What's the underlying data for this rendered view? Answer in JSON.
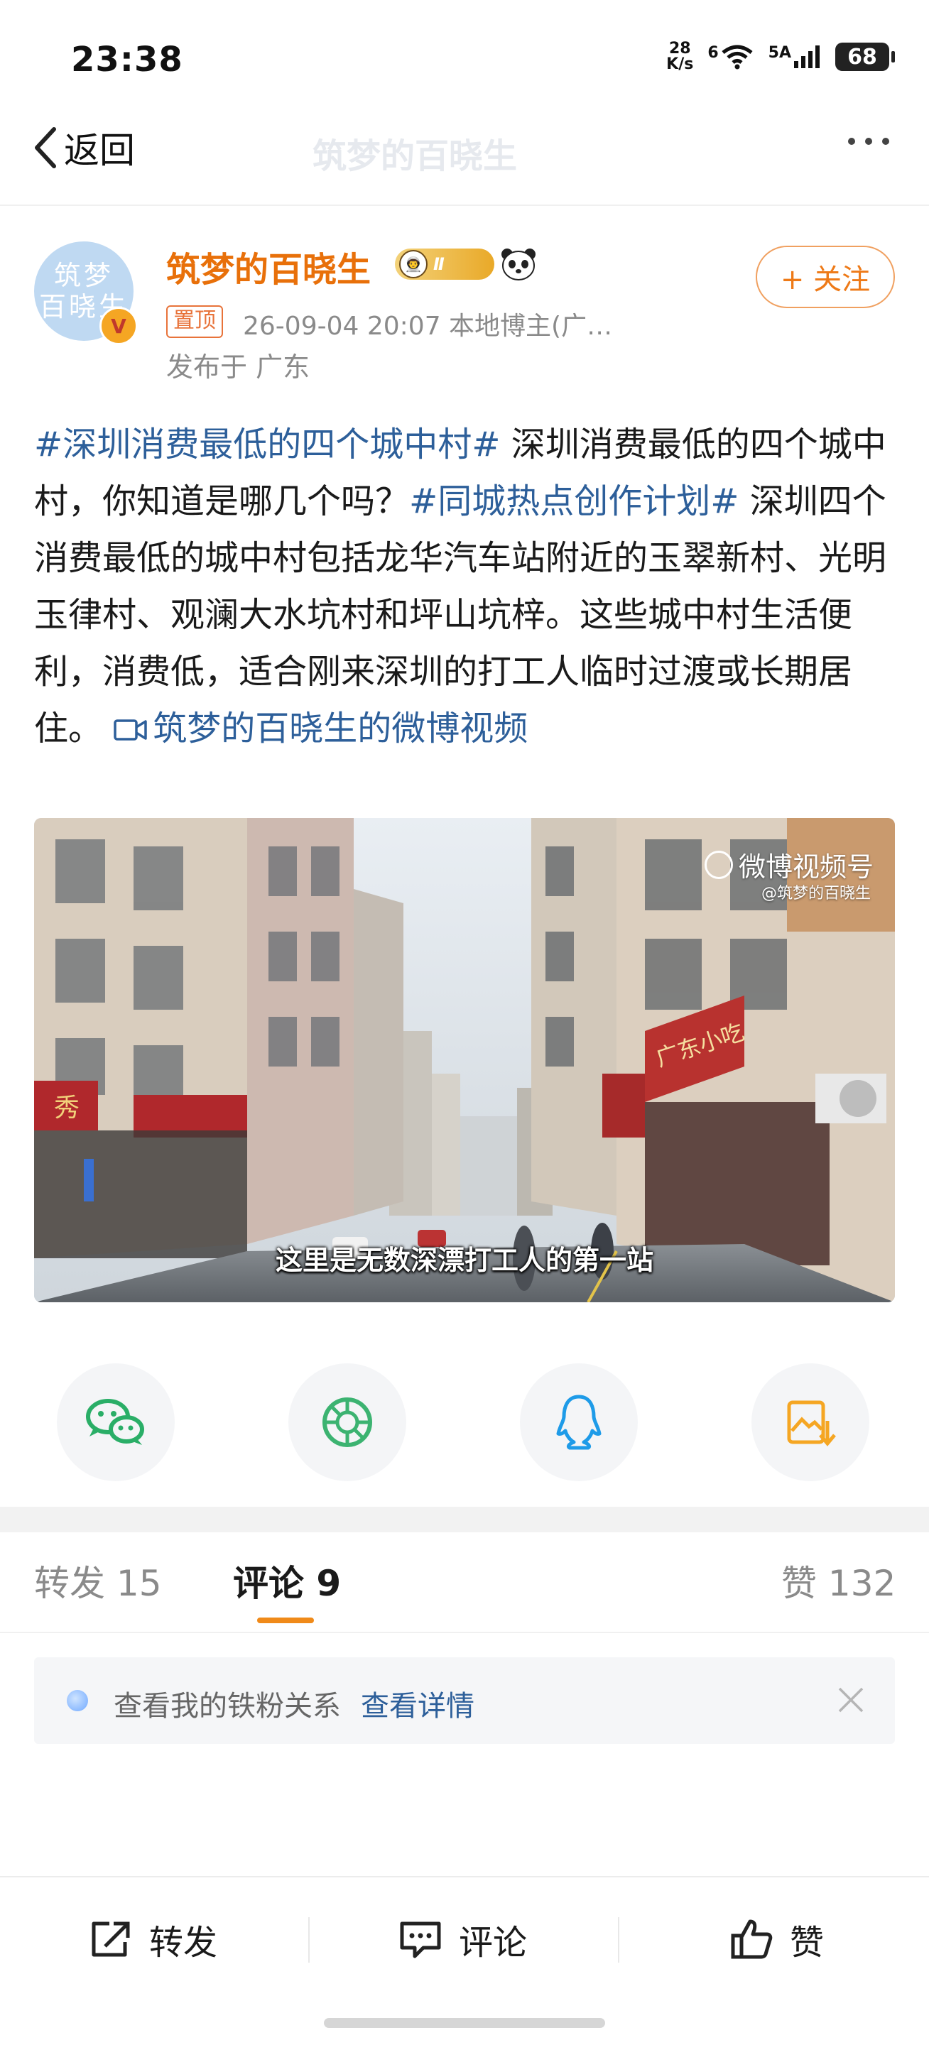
{
  "status_bar": {
    "time": "23:38",
    "net_speed_value": "28",
    "net_speed_unit": "K/s",
    "wifi_label": "6",
    "signal_label": "5A",
    "battery": "68"
  },
  "nav": {
    "back_label": "返回",
    "ghost_title": "筑梦的百晓生"
  },
  "post": {
    "author": "筑梦的百晓生",
    "avatar_line1": "筑梦",
    "avatar_line2": "百晓生",
    "verified_mark": "V",
    "level_text": "Ⅱ",
    "pin_label": "置顶",
    "meta": "26-09-04 20:07  本地博主(广…",
    "location": "发布于 广东",
    "follow_label": "+ 关注",
    "tag1": "#深圳消费最低的四个城中村#",
    "text1": " 深圳消费最低的四个城中村，你知道是哪几个吗？",
    "tag2": "#同城热点创作计划#",
    "text2": " 深圳四个消费最低的城中村包括龙华汽车站附近的玉翠新村、光明玉律村、观澜大水坑村和坪山坑梓。这些城中村生活便利，消费低，适合刚来深圳的打工人临时过渡或长期居住。 ",
    "video_link": "筑梦的百晓生的微博视频"
  },
  "video": {
    "watermark": "微博视频号",
    "watermark_sub": "@筑梦的百晓生",
    "subtitle": "这里是无数深漂打工人的第一站",
    "shop_sign_left": "秀",
    "shop_sign_right": "广东小吃"
  },
  "share": {
    "icons": [
      "wechat-icon",
      "moments-icon",
      "qq-icon",
      "save-image-icon"
    ],
    "colors": {
      "wechat": "#2aae67",
      "moments": "#3cb371",
      "qq": "#1e9be8",
      "save": "#f5a623"
    }
  },
  "tabs": {
    "repost_label": "转发",
    "repost_count": "15",
    "comment_label": "评论",
    "comment_count": "9",
    "like_label": "赞",
    "like_count": "132"
  },
  "fan_banner": {
    "text": "查看我的铁粉关系",
    "link": "查看详情"
  },
  "bottom_bar": {
    "repost": "转发",
    "comment": "评论",
    "like": "赞"
  },
  "colors": {
    "accent": "#f08a19",
    "link": "#2d5f9a",
    "author": "#e8700a"
  }
}
